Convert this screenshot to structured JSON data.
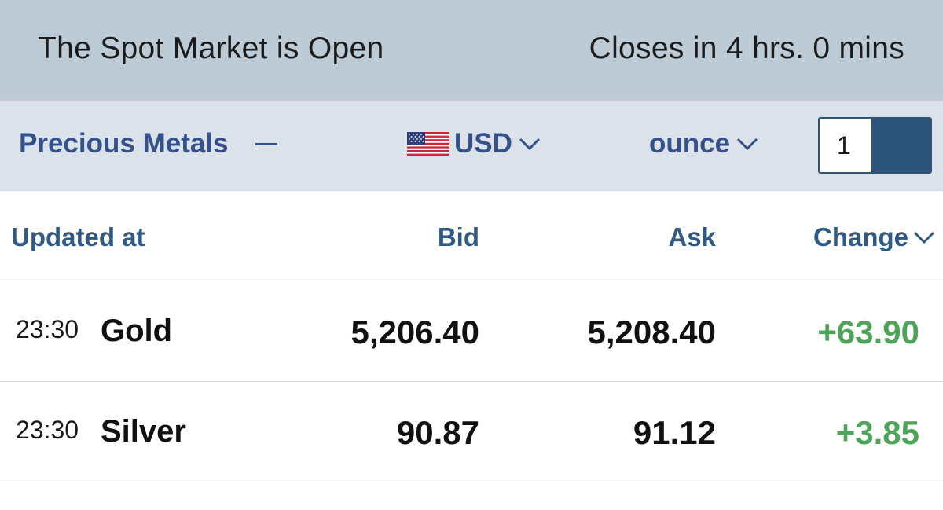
{
  "status": {
    "market_state": "The Spot Market is Open",
    "closes_in": "Closes in 4 hrs. 0 mins"
  },
  "toolbar": {
    "metal_group": "Precious Metals",
    "currency": "USD",
    "currency_icon": "us-flag-icon",
    "unit": "ounce",
    "quantity": "1"
  },
  "table": {
    "headers": {
      "updated_at": "Updated at",
      "bid": "Bid",
      "ask": "Ask",
      "change": "Change"
    },
    "rows": [
      {
        "time": "23:30",
        "name": "Gold",
        "bid": "5,206.40",
        "ask": "5,208.40",
        "change": "+63.90"
      },
      {
        "time": "23:30",
        "name": "Silver",
        "bid": "90.87",
        "ask": "91.12",
        "change": "+3.85"
      }
    ]
  },
  "colors": {
    "status_bar_bg": "#bccbd6",
    "toolbar_bg": "#dbe2e9",
    "accent_blue": "#34518c",
    "header_blue": "#2e5a85",
    "positive_green": "#4ea55a",
    "toggle_dark": "#2c5378"
  }
}
